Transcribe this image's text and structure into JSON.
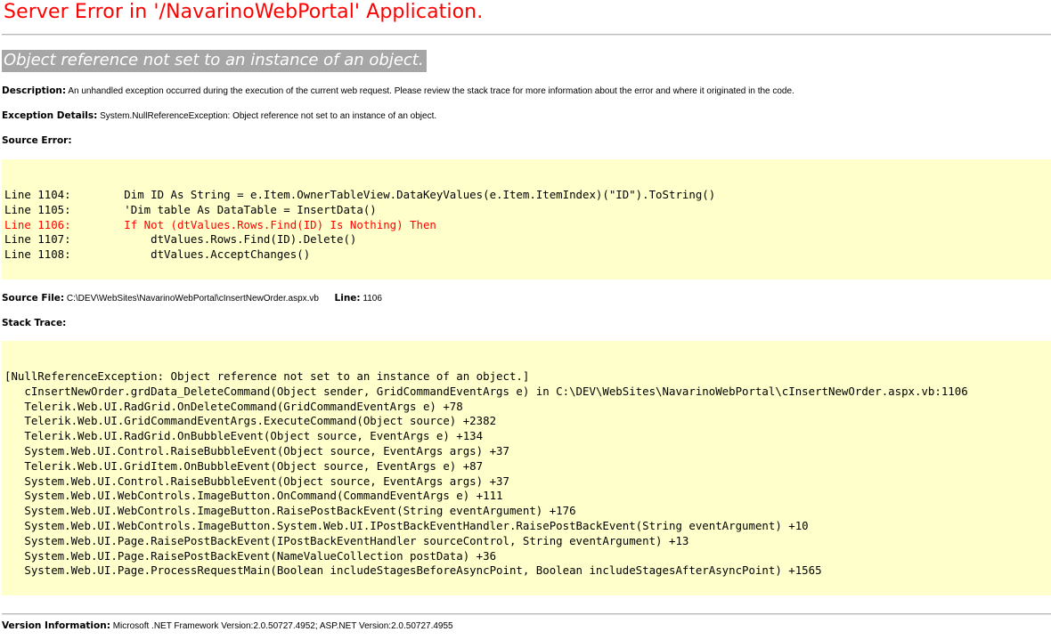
{
  "page": {
    "title": "Server Error in '/NavarinoWebPortal' Application.",
    "error_message": "Object reference not set to an instance of an object.",
    "description_label": "Description:",
    "description_text": "An unhandled exception occurred during the execution of the current web request. Please review the stack trace for more information about the error and where it originated in the code.",
    "exception_label": "Exception Details:",
    "exception_text": "System.NullReferenceException: Object reference not set to an instance of an object.",
    "source_error_label": "Source Error:",
    "source_lines": [
      {
        "text": "Line 1104:        Dim ID As String = e.Item.OwnerTableView.DataKeyValues(e.Item.ItemIndex)(\"ID\").ToString()",
        "highlight": false
      },
      {
        "text": "Line 1105:        'Dim table As DataTable = InsertData()",
        "highlight": false
      },
      {
        "text": "Line 1106:        If Not (dtValues.Rows.Find(ID) Is Nothing) Then",
        "highlight": true
      },
      {
        "text": "Line 1107:            dtValues.Rows.Find(ID).Delete()",
        "highlight": false
      },
      {
        "text": "Line 1108:            dtValues.AcceptChanges()",
        "highlight": false
      }
    ],
    "source_file_label": "Source File:",
    "source_file_value": "C:\\DEV\\WebSites\\NavarinoWebPortal\\cInsertNewOrder.aspx.vb",
    "line_label": "Line:",
    "line_value": "1106",
    "stack_trace_label": "Stack Trace:",
    "stack_lines": [
      "[NullReferenceException: Object reference not set to an instance of an object.]",
      "   cInsertNewOrder.grdData_DeleteCommand(Object sender, GridCommandEventArgs e) in C:\\DEV\\WebSites\\NavarinoWebPortal\\cInsertNewOrder.aspx.vb:1106",
      "   Telerik.Web.UI.RadGrid.OnDeleteCommand(GridCommandEventArgs e) +78",
      "   Telerik.Web.UI.GridCommandEventArgs.ExecuteCommand(Object source) +2382",
      "   Telerik.Web.UI.RadGrid.OnBubbleEvent(Object source, EventArgs e) +134",
      "   System.Web.UI.Control.RaiseBubbleEvent(Object source, EventArgs args) +37",
      "   Telerik.Web.UI.GridItem.OnBubbleEvent(Object source, EventArgs e) +87",
      "   System.Web.UI.Control.RaiseBubbleEvent(Object source, EventArgs args) +37",
      "   System.Web.UI.WebControls.ImageButton.OnCommand(CommandEventArgs e) +111",
      "   System.Web.UI.WebControls.ImageButton.RaisePostBackEvent(String eventArgument) +176",
      "   System.Web.UI.WebControls.ImageButton.System.Web.UI.IPostBackEventHandler.RaisePostBackEvent(String eventArgument) +10",
      "   System.Web.UI.Page.RaisePostBackEvent(IPostBackEventHandler sourceControl, String eventArgument) +13",
      "   System.Web.UI.Page.RaisePostBackEvent(NameValueCollection postData) +36",
      "   System.Web.UI.Page.ProcessRequestMain(Boolean includeStagesBeforeAsyncPoint, Boolean includeStagesAfterAsyncPoint) +1565"
    ],
    "version_label": "Version Information:",
    "version_text": "Microsoft .NET Framework Version:2.0.50727.4952; ASP.NET Version:2.0.50727.4955"
  },
  "colors": {
    "title": "#ff0000",
    "code_background": "#ffffcc",
    "highlight_line": "#ff0000",
    "error_message_background": "#a6a6a6"
  }
}
